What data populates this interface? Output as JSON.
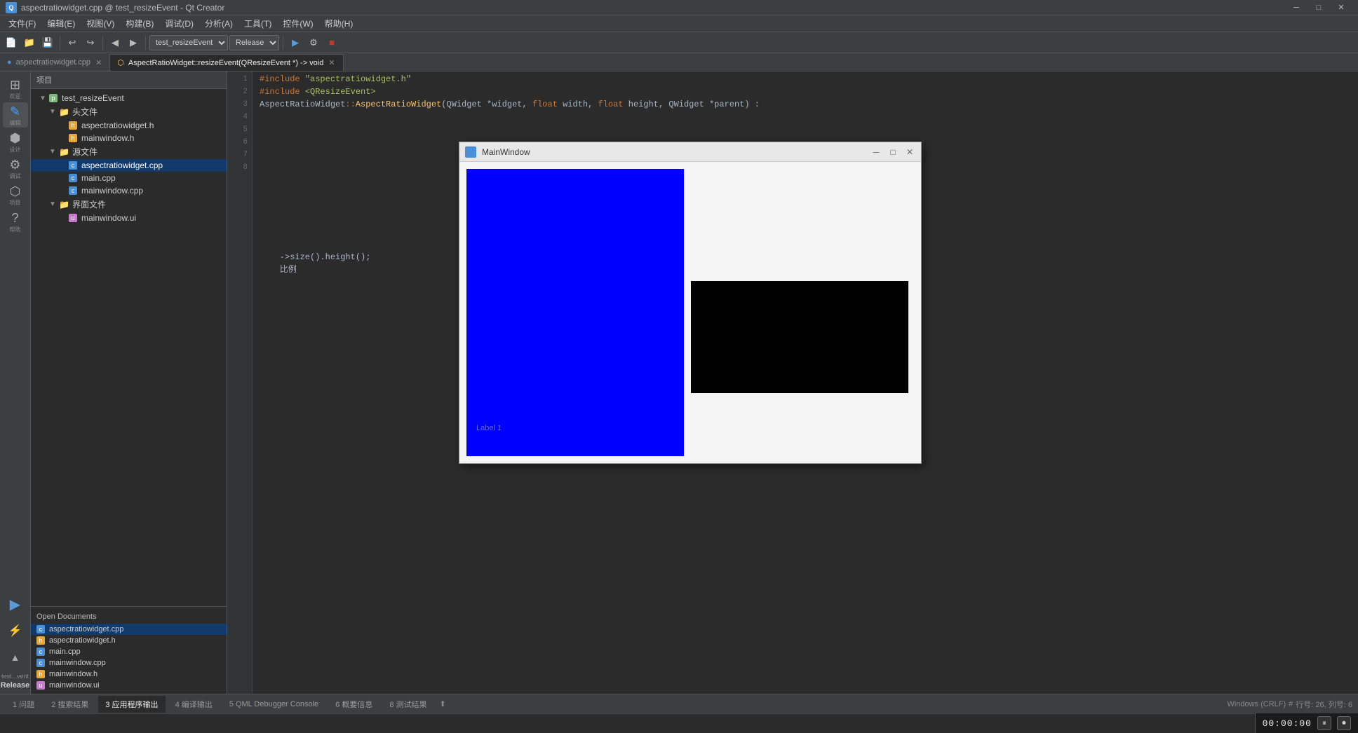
{
  "title_bar": {
    "app_icon_text": "Q",
    "title": "aspectratiowidget.cpp @ test_resizeEvent - Qt Creator",
    "minimize": "─",
    "maximize": "□",
    "close": "✕"
  },
  "menu_bar": {
    "items": [
      {
        "label": "文件(F)"
      },
      {
        "label": "编辑(E)"
      },
      {
        "label": "视图(V)"
      },
      {
        "label": "构建(B)"
      },
      {
        "label": "调试(D)"
      },
      {
        "label": "分析(A)"
      },
      {
        "label": "工具(T)"
      },
      {
        "label": "控件(W)"
      },
      {
        "label": "帮助(H)"
      }
    ]
  },
  "toolbar": {
    "project_combo": "test_resizeEvent",
    "build_combo": "Release"
  },
  "tabs": [
    {
      "label": "aspectratiowidget.cpp",
      "icon": "cpp",
      "active": false,
      "closeable": true
    },
    {
      "label": "AspectRatioWidget::resizeEvent(QResizeEvent *) -> void",
      "icon": "func",
      "active": true,
      "closeable": true
    }
  ],
  "icon_rail": {
    "buttons": [
      {
        "icon": "⊞",
        "label": "欢迎",
        "active": false
      },
      {
        "icon": "✎",
        "label": "编辑",
        "active": true
      },
      {
        "icon": "⬢",
        "label": "设计",
        "active": false
      },
      {
        "icon": "⚙",
        "label": "调试",
        "active": false
      },
      {
        "icon": "⬡",
        "label": "项目",
        "active": false
      },
      {
        "icon": "?",
        "label": "帮助",
        "active": false
      }
    ],
    "bottom_buttons": [
      {
        "icon": "▶",
        "label": ""
      },
      {
        "icon": "⚡",
        "label": ""
      },
      {
        "icon": "▲",
        "label": ""
      }
    ]
  },
  "project_panel": {
    "header": "项目",
    "tree": [
      {
        "indent": 0,
        "arrow": "▼",
        "icon": "pro",
        "label": "test_resizeEvent",
        "type": "project"
      },
      {
        "indent": 1,
        "arrow": "▼",
        "icon": "folder",
        "label": "头文件",
        "type": "folder"
      },
      {
        "indent": 2,
        "arrow": "",
        "icon": "h",
        "label": "aspectratiowidget.h",
        "type": "file"
      },
      {
        "indent": 2,
        "arrow": "",
        "icon": "h",
        "label": "mainwindow.h",
        "type": "file"
      },
      {
        "indent": 1,
        "arrow": "▼",
        "icon": "folder",
        "label": "源文件",
        "type": "folder"
      },
      {
        "indent": 2,
        "arrow": "",
        "icon": "cpp",
        "label": "aspectratiowidget.cpp",
        "type": "file",
        "selected": true
      },
      {
        "indent": 2,
        "arrow": "",
        "icon": "cpp",
        "label": "main.cpp",
        "type": "file"
      },
      {
        "indent": 2,
        "arrow": "",
        "icon": "cpp",
        "label": "mainwindow.cpp",
        "type": "file"
      },
      {
        "indent": 1,
        "arrow": "▼",
        "icon": "folder",
        "label": "界面文件",
        "type": "folder"
      },
      {
        "indent": 2,
        "arrow": "",
        "icon": "ui",
        "label": "mainwindow.ui",
        "type": "file"
      }
    ]
  },
  "open_documents": {
    "header": "Open Documents",
    "items": [
      {
        "icon": "cpp",
        "label": "aspectratiowidget.cpp",
        "selected": true
      },
      {
        "icon": "h",
        "label": "aspectratiowidget.h"
      },
      {
        "icon": "cpp",
        "label": "main.cpp"
      },
      {
        "icon": "cpp",
        "label": "mainwindow.cpp"
      },
      {
        "icon": "h",
        "label": "mainwindow.h"
      },
      {
        "icon": "ui",
        "label": "mainwindow.ui"
      }
    ]
  },
  "build_config": {
    "mode_label": "test...vent",
    "config_label": "Release"
  },
  "code": {
    "lines": [
      {
        "num": "1",
        "content": "#include \"aspectratiowidget.h\""
      },
      {
        "num": "2",
        "content": "#include <QResizeEvent>"
      },
      {
        "num": "3",
        "content": ""
      },
      {
        "num": "4",
        "content": "AspectRatioWidget::AspectRatioWidget(QWidget *widget, float width, float height, QWidget *parent) :"
      }
    ],
    "partial_lines": [
      {
        "content": "    ->size().height();"
      },
      {
        "content": "    比例"
      },
      {
        "content": ""
      }
    ]
  },
  "mainwindow_preview": {
    "title": "MainWindow",
    "label1": "Label 1",
    "blue_widget_color": "#0000ff",
    "black_widget_color": "#000000"
  },
  "status_bar": {
    "issues": "1 问题",
    "search_results": "2 搜索结果",
    "app_output": "3 应用程序输出",
    "compile_output": "4 编译输出",
    "qml_console": "5 QML Debugger Console",
    "overview": "6 概要信息",
    "test_results": "8 测试结果",
    "arrow": "⬆"
  },
  "cursor_pos": {
    "line": "行号: 26",
    "col": "列号: 6"
  },
  "file_info": {
    "encoding": "Windows (CRLF)",
    "format": "#"
  },
  "timer": {
    "display": "00:00:00",
    "pause": "⏸",
    "record": "⏺"
  }
}
